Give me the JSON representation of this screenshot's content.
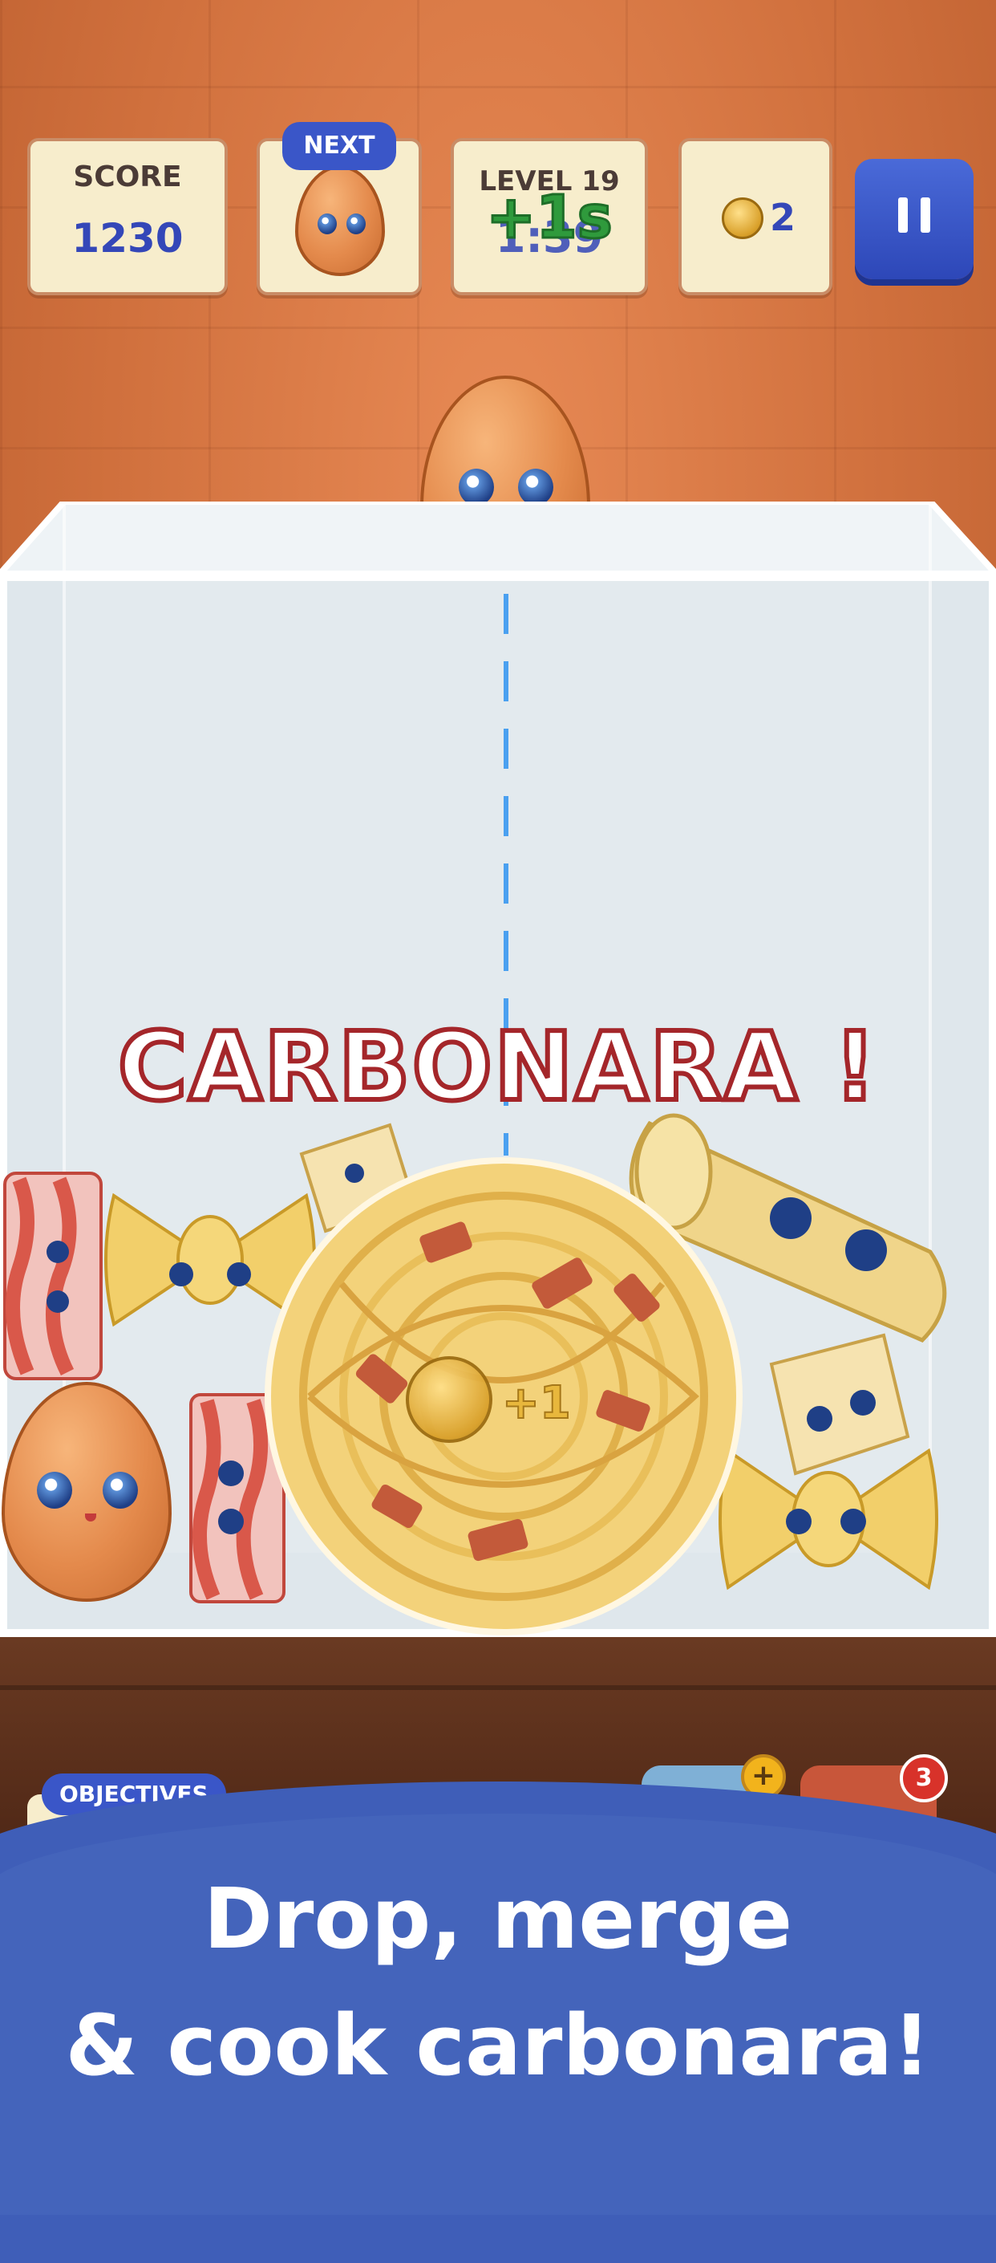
{
  "hud": {
    "score_label": "SCORE",
    "score_value": "1230",
    "next_label": "NEXT",
    "level_label": "LEVEL 19",
    "timer_value": "1:39",
    "time_bonus": "+1s",
    "coins_value": "2"
  },
  "board": {
    "merge_text": "CARBONARA !",
    "coin_gain": "+1"
  },
  "bottom_bar": {
    "objectives_label": "OBJECTIVES",
    "boost_plus": "+",
    "item_count": "3"
  },
  "promo": {
    "line1": "Drop, merge",
    "line2": "& cook carbonara!"
  },
  "colors": {
    "accent_blue": "#3447b8",
    "banner_blue": "#4464bb",
    "merge_outline": "#a4262a",
    "bonus_green": "#2f9a3c"
  },
  "icons": [
    "pause-icon",
    "coin-icon",
    "egg-icon",
    "bacon-icon",
    "farfalle-icon",
    "penne-icon",
    "parmesan-icon",
    "spaghetti-icon"
  ]
}
